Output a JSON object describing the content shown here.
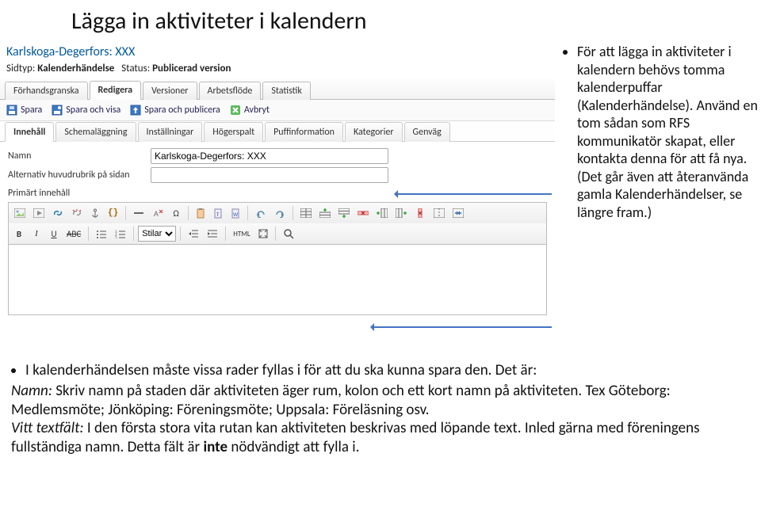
{
  "page_title": "Lägga in aktiviteter i kalendern",
  "editor": {
    "breadcrumb": "Karlskoga-Degerfors: XXX",
    "meta": {
      "sidtyp_label": "Sidtyp:",
      "sidtyp_value": "Kalenderhändelse",
      "status_label": "Status:",
      "status_value": "Publicerad version"
    },
    "tabs": {
      "preview": "Förhandsgranska",
      "edit": "Redigera",
      "versions": "Versioner",
      "workflow": "Arbetsflöde",
      "stats": "Statistik"
    },
    "actions": {
      "save": "Spara",
      "save_view": "Spara och visa",
      "save_publish": "Spara och publicera",
      "cancel": "Avbryt"
    },
    "subtabs": {
      "content": "Innehåll",
      "schedule": "Schemaläggning",
      "settings": "Inställningar",
      "rightcol": "Högerspalt",
      "puff": "Puffinformation",
      "categories": "Kategorier",
      "shortcut": "Genväg"
    },
    "fields": {
      "name_label": "Namn",
      "name_value": "Karlskoga-Degerfors: XXX",
      "alt_heading_label": "Alternativ huvudrubrik på sidan",
      "alt_heading_value": "",
      "primary_content_label": "Primärt innehåll"
    },
    "rte": {
      "styles_select": "Stilar",
      "html_btn": "HTML"
    }
  },
  "side_bullet": "För att lägga in aktiviteter i kalendern behövs tomma kalenderpuffar (Kalenderhändelse). Använd en tom sådan som RFS kommunikatör skapat, eller kontakta denna för att få nya. (Det går även att återanvända gamla Kalenderhändelser, se längre fram.)",
  "bottom": {
    "bullet": "I kalenderhändelsen måste vissa rader fyllas i för att du ska kunna spara den. Det är:",
    "line1_label": "Namn:",
    "line1_text": " Skriv namn på staden där aktiviteten äger rum, kolon och ett kort namn på aktiviteten. Tex Göteborg: Medlemsmöte; Jönköping: Föreningsmöte; Uppsala: Föreläsning osv.",
    "line2_label": "Vitt textfält:",
    "line2_text_a": " I den första stora vita rutan kan aktiviteten beskrivas med löpande text. Inled gärna med föreningens fullständiga namn. Detta fält är ",
    "line2_bold": "inte",
    "line2_text_b": " nödvändigt att fylla i."
  }
}
